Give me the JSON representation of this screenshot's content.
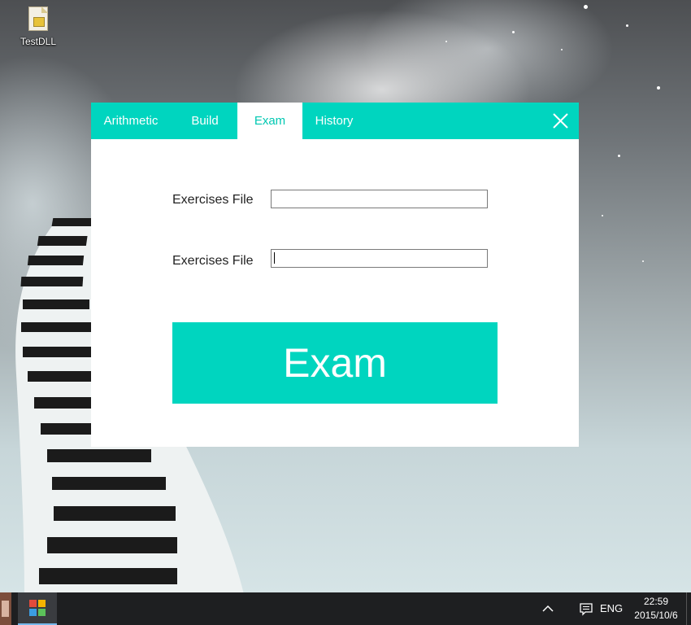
{
  "desktop": {
    "icons": [
      {
        "label": "TestDLL",
        "icon": "zip-folder-icon"
      }
    ]
  },
  "window": {
    "tabs": [
      {
        "label": "Arithmetic",
        "active": false
      },
      {
        "label": "Build",
        "active": false
      },
      {
        "label": "Exam",
        "active": true
      },
      {
        "label": "History",
        "active": false
      }
    ],
    "close_icon": "close-icon",
    "accent_color": "#00d5bf",
    "form": {
      "field1": {
        "label": "Exercises File",
        "value": "",
        "placeholder": ""
      },
      "field2": {
        "label": "Exercises File",
        "value": "",
        "placeholder": "",
        "focused": true
      }
    },
    "exam_button_label": "Exam"
  },
  "taskbar": {
    "apps": [
      {
        "icon": "pinned-app-icon"
      },
      {
        "icon": "cube-app-icon",
        "active": true
      }
    ],
    "tray": {
      "up_icon": "chevron-up-icon",
      "message_icon": "action-center-icon",
      "language": "ENG",
      "time": "22:59",
      "date": "2015/10/6"
    }
  }
}
